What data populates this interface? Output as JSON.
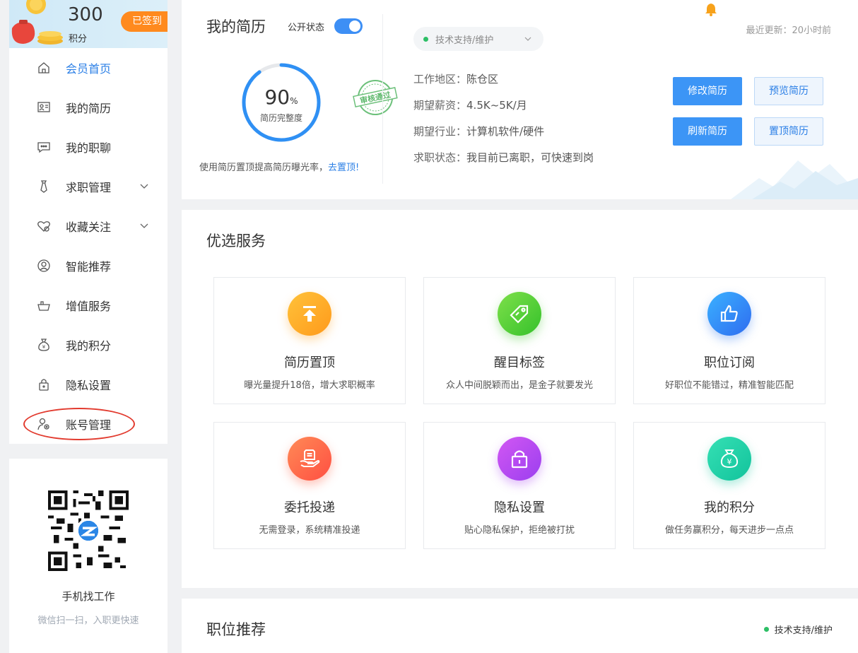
{
  "sidebar": {
    "points": "300",
    "points_label": "积分",
    "signed_label": "已签到",
    "items": [
      {
        "label": "会员首页"
      },
      {
        "label": "我的简历"
      },
      {
        "label": "我的职聊"
      },
      {
        "label": "求职管理"
      },
      {
        "label": "收藏关注"
      },
      {
        "label": "智能推荐"
      },
      {
        "label": "增值服务"
      },
      {
        "label": "我的积分"
      },
      {
        "label": "隐私设置"
      },
      {
        "label": "账号管理"
      }
    ],
    "qr_title": "手机找工作",
    "qr_sub": "微信扫一扫，入职更快速"
  },
  "resume": {
    "title": "我的简历",
    "public_label": "公开状态",
    "completeness": "90",
    "percent_sign": "%",
    "completeness_label": "简历完整度",
    "stamp_text": "审核通过",
    "tip_text": "使用简历置顶提高简历曝光率，",
    "tip_link": "去置顶!",
    "job_pill": "技术支持/维护",
    "updated": "最近更新：20小时前",
    "rows": [
      {
        "k": "工作地区：",
        "v": "陈仓区"
      },
      {
        "k": "期望薪资：",
        "v": "4.5K~5K/月"
      },
      {
        "k": "期望行业：",
        "v": "计算机软件/硬件"
      },
      {
        "k": "求职状态：",
        "v": "我目前已离职，可快速到岗"
      }
    ],
    "buttons": {
      "edit": "修改简历",
      "preview": "预览简历",
      "refresh": "刷新简历",
      "top": "置顶简历"
    }
  },
  "services": {
    "title": "优选服务",
    "tiles": [
      {
        "name": "简历置顶",
        "desc": "曝光量提升18倍，增大求职概率",
        "icon": "arrow-up-icon",
        "color": "#ffa51f"
      },
      {
        "name": "醒目标签",
        "desc": "众人中间脱颖而出，是金子就要发光",
        "icon": "tag-icon",
        "color": "#4fcf3a"
      },
      {
        "name": "职位订阅",
        "desc": "好职位不能错过，精准智能匹配",
        "icon": "thumbs-up-icon",
        "color": "#2f7cf6"
      },
      {
        "name": "委托投递",
        "desc": "无需登录，系统精准投递",
        "icon": "hand-document-icon",
        "color": "#ff6a4a"
      },
      {
        "name": "隐私设置",
        "desc": "贴心隐私保护，拒绝被打扰",
        "icon": "lock-icon",
        "color": "#b04af0"
      },
      {
        "name": "我的积分",
        "desc": "做任务赢积分，每天进步一点点",
        "icon": "money-bag-icon",
        "color": "#1ccfa7"
      }
    ]
  },
  "recommend": {
    "title": "职位推荐",
    "tag": "技术支持/维护"
  }
}
